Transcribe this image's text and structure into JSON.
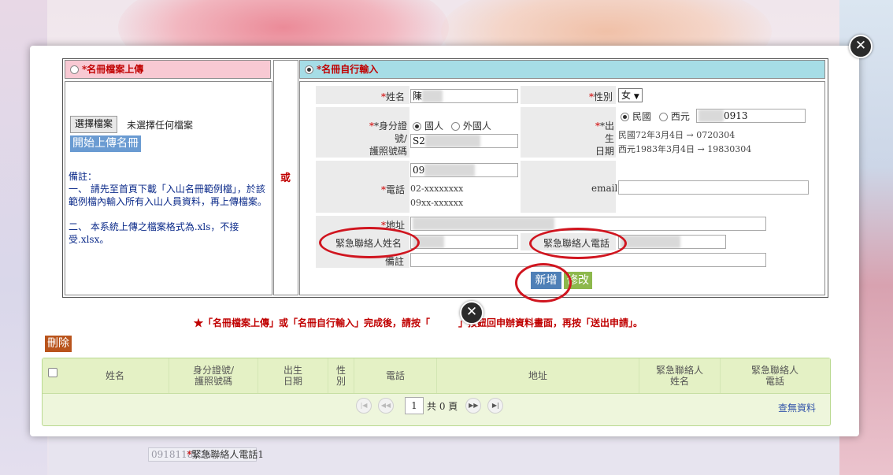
{
  "background": {
    "under_field_label": "緊急聯絡人電話1",
    "under_field_value": "0918118826"
  },
  "upload_panel": {
    "header": "*名冊檔案上傳",
    "choose_file_button": "選擇檔案",
    "no_file_text": "未選擇任何檔案",
    "upload_button": "開始上傳名冊",
    "note_title": "備註：",
    "note_1": "一、 請先至首頁下載「入山名冊範例檔」，於該範例檔內輸入所有入山人員資料，再上傳檔案。",
    "note_2": "二、 本系統上傳之檔案格式為.xls，不接受.xlsx。"
  },
  "or_label": "或",
  "manual_panel": {
    "header": "*名冊自行輸入",
    "name_label": "*姓名",
    "name_value": "陳",
    "gender_label": "*性別",
    "gender_value": "女",
    "id_label_1": "*身分證號/",
    "id_label_2": "護照號碼",
    "id_opt_citizen": "國人",
    "id_opt_foreign": "外國人",
    "id_value": "S2",
    "birth_label_1": "*出生",
    "birth_label_2": "日期",
    "birth_opt_roc": "民國",
    "birth_opt_ad": "西元",
    "birth_value": "0913",
    "birth_hint_1": "民國72年3月4日 → 0720304",
    "birth_hint_2": "西元1983年3月4日 → 19830304",
    "phone_label": "*電話",
    "phone_value": "09",
    "phone_hint_1": "02-xxxxxxxx",
    "phone_hint_2": "09xx-xxxxxx",
    "email_label": "email",
    "address_label": "*地址",
    "emergency_name_label": "緊急聯絡人姓名",
    "emergency_phone_label": "緊急聯絡人電話",
    "remark_label": "備註",
    "add_button": "新增",
    "edit_button": "修改"
  },
  "notice": {
    "star": "★",
    "text_before": "「名冊檔案上傳」或「名冊自行輸入」完成後，請按「",
    "text_after": "」按鈕回申辦資料畫面，再按「送出申請」。"
  },
  "delete_button": "刪除",
  "grid": {
    "columns": [
      "姓名",
      "身分證號/\n護照號碼",
      "出生\n日期",
      "性\n別",
      "電話",
      "地址",
      "緊急聯絡人\n姓名",
      "緊急聯絡人\n電話"
    ],
    "page_value": "1",
    "page_total": "共 0 頁",
    "no_data": "查無資料"
  },
  "colors": {
    "accent_red": "#c00000",
    "header_pink": "#f8c9d3",
    "header_blue": "#a6dde6",
    "add_button": "#4f80b7",
    "edit_button": "#8db84c",
    "delete_button": "#b9541c",
    "grid_bg": "#eef6dc"
  }
}
